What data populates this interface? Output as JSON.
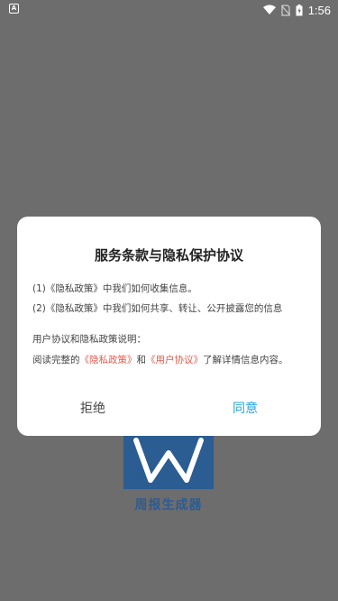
{
  "status_bar": {
    "app_badge": "A",
    "time": "1:56",
    "icons": [
      "wifi-icon",
      "no-sim-icon",
      "battery-icon"
    ]
  },
  "app": {
    "logo_caption": "周报生成器"
  },
  "dialog": {
    "title": "服务条款与隐私保护协议",
    "line1": "(1)《隐私政策》中我们如何收集信息。",
    "line2": "(2)《隐私政策》中我们如何共享、转让、公开披露您的信息",
    "line3": "用户协议和隐私政策说明：",
    "line4_prefix": "阅读完整的",
    "privacy_link": "《隐私政策》",
    "line4_middle": "和",
    "user_agreement_link": "《用户协议》",
    "line4_suffix": "了解详情信息内容。",
    "refuse_label": "拒绝",
    "agree_label": "同意"
  },
  "colors": {
    "overlay": "#6d6d6d",
    "link": "#e55a4e",
    "accent": "#20a4dc",
    "logo": "#2b5c92"
  }
}
